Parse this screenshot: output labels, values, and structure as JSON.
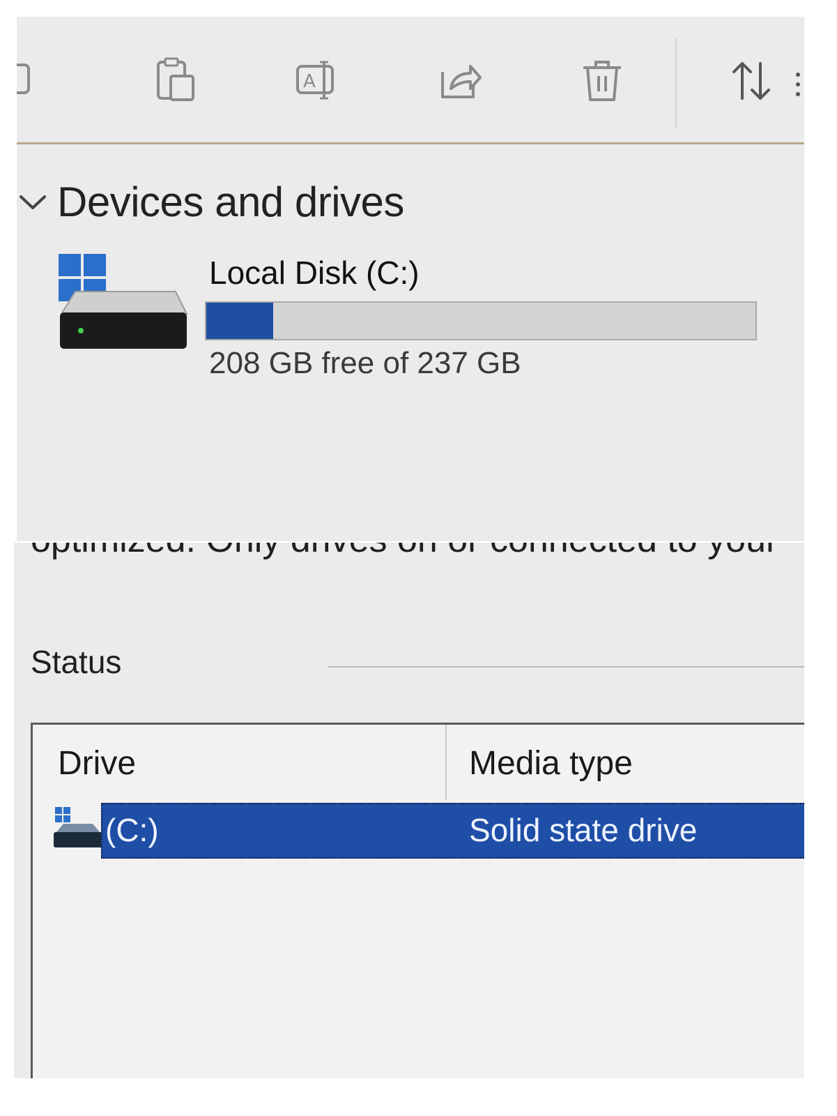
{
  "toolbar": {
    "buttons": [
      {
        "icon": "copy-icon"
      },
      {
        "icon": "paste-icon"
      },
      {
        "icon": "rename-icon"
      },
      {
        "icon": "share-icon"
      },
      {
        "icon": "delete-icon"
      },
      {
        "icon": "sort-icon"
      }
    ]
  },
  "devices": {
    "section_title": "Devices and drives",
    "drive": {
      "name": "Local Disk (C:)",
      "free_text": "208 GB free of 237 GB",
      "used_fraction": 0.122
    }
  },
  "optimize": {
    "cut_text": "optimized. Only drives on or connected to your",
    "status_label": "Status",
    "columns": {
      "drive": "Drive",
      "media_type": "Media type"
    },
    "rows": [
      {
        "drive": "(C:)",
        "media_type": "Solid state drive",
        "selected": true
      }
    ]
  },
  "colors": {
    "accent": "#1f4ea6",
    "usage_fill": "#1e4fa3",
    "windows_logo": "#2a6fc9"
  }
}
